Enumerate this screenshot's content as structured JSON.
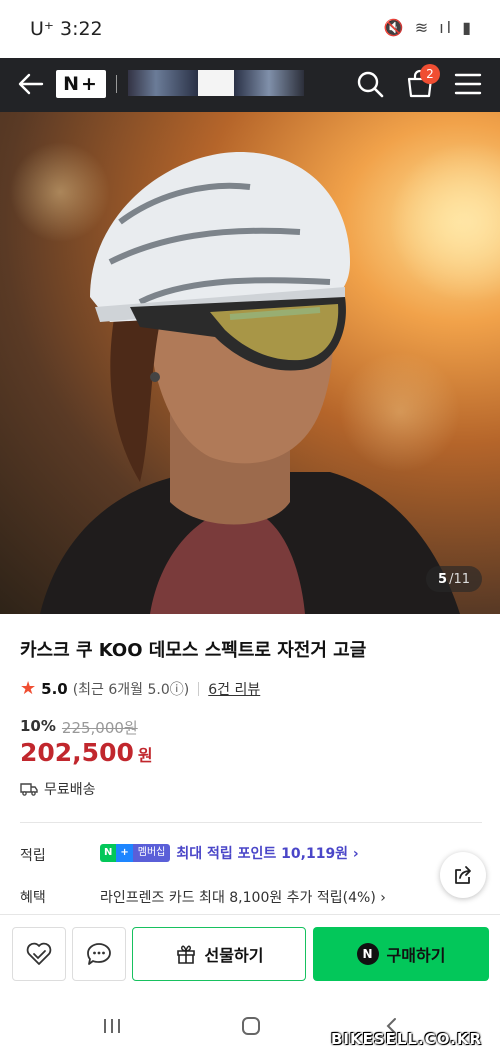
{
  "status_bar": {
    "carrier": "U⁺ 3:22",
    "icons": "🔇 ≋ ıl ▮"
  },
  "nav": {
    "logo_text": "N+",
    "cart_count": "2"
  },
  "hero": {
    "pager_current": "5",
    "pager_total": "/11"
  },
  "product": {
    "title": "카스크 쿠 KOO 데모스 스펙트로 자전거 고글",
    "rating_score": "5.0",
    "rating_detail": "(최근 6개월 5.0ⓘ)",
    "review_link": "6건 리뷰",
    "discount_pct": "10%",
    "original_price": "225,000원",
    "price": "202,500",
    "price_unit": "원",
    "shipping": "무료배송"
  },
  "points": {
    "label": "적립",
    "badge_n": "N",
    "badge_plus": "+",
    "badge_member": "멤버십",
    "text": "최대 적립 포인트 10,119원 ›"
  },
  "benefit": {
    "label": "혜택",
    "text": "라인프렌즈 카드 최대 8,100원 추가 적립(4%) ›"
  },
  "bottom_bar": {
    "gift_label": "선물하기",
    "buy_label": "구매하기",
    "buy_badge": "N"
  },
  "watermark": "BIKESELL.CO.KR",
  "colors": {
    "accent_green": "#03c75a",
    "price_red": "#c1272d",
    "badge_red": "#f04e32"
  }
}
